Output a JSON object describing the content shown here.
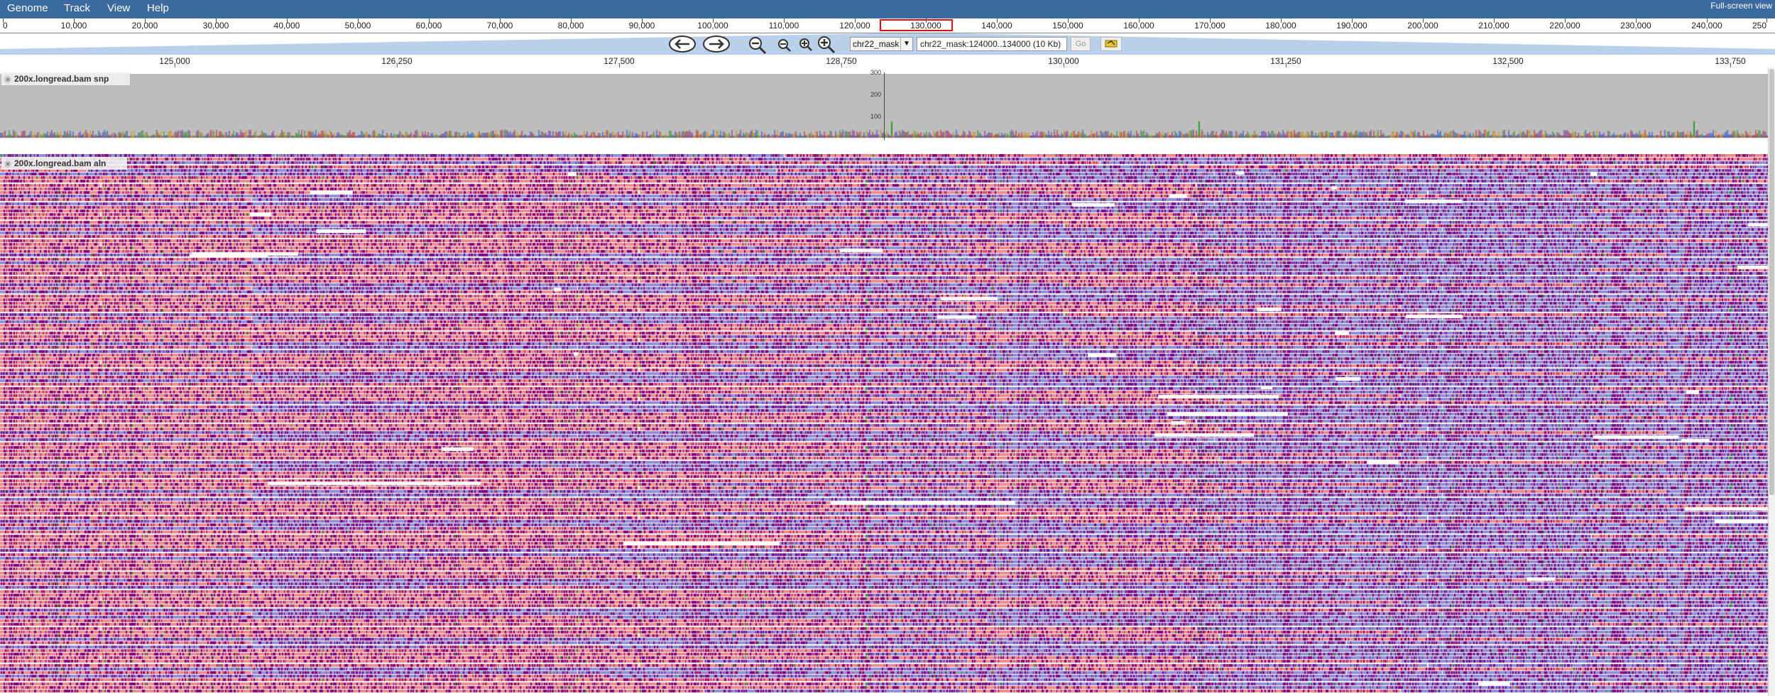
{
  "menu": {
    "items": [
      {
        "label": "Genome"
      },
      {
        "label": "Track"
      },
      {
        "label": "View"
      },
      {
        "label": "Help"
      }
    ],
    "fullscreen_label": "Full-screen view"
  },
  "overview": {
    "labels": [
      "0",
      "10,000",
      "20,000",
      "30,000",
      "40,000",
      "50,000",
      "60,000",
      "70,000",
      "80,000",
      "90,000",
      "100,000",
      "110,000",
      "120,000",
      "130,000",
      "140,000",
      "150,000",
      "160,000",
      "170,000",
      "180,000",
      "190,000",
      "200,000",
      "210,000",
      "220,000",
      "230,000",
      "240,000",
      "250"
    ]
  },
  "navigation": {
    "left_label": "pan left",
    "right_label": "pan right",
    "ref_seq": "chr22_mask",
    "location": "chr22_mask:124000..134000 (10 Kb)",
    "go_label": "Go"
  },
  "ruler": {
    "labels": [
      "125,000",
      "126,250",
      "127,500",
      "128,750",
      "130,000",
      "131,250",
      "132,500",
      "133,750"
    ]
  },
  "tracks": {
    "snp": {
      "label": "200x.longread.bam snp",
      "axis_labels": [
        "300",
        "200",
        "100"
      ]
    },
    "alignments": {
      "label": "200x.longread.bam aln"
    }
  },
  "colors": {
    "menubar": "#3a6aa0",
    "read_forward": "#ec8b8b",
    "read_reverse": "#8f8fd8",
    "mismatch_purple": "#800080",
    "coverage_gray": "#bdbdbd",
    "highlight_red": "#e01010"
  },
  "icons": {
    "pan_left": "arrow-left-icon",
    "pan_right": "arrow-right-icon",
    "zoom_out_big": "zoom-out-large-icon",
    "zoom_out": "zoom-out-icon",
    "zoom_in": "zoom-in-icon",
    "zoom_in_big": "zoom-in-large-icon",
    "highlight": "highlighter-icon"
  }
}
